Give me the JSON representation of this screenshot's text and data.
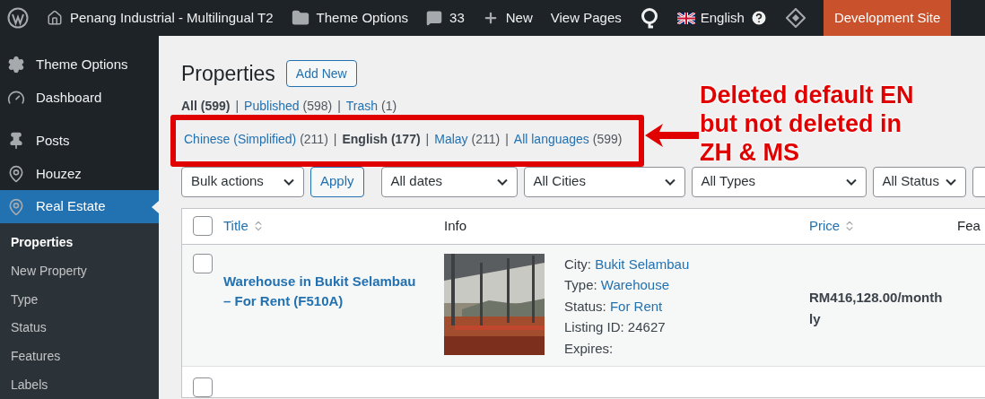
{
  "admin_bar": {
    "site_name": "Penang Industrial - Multilingual T2",
    "theme_options": "Theme Options",
    "comments": "33",
    "new": "New",
    "view_pages": "View Pages",
    "language": "English",
    "environment": "Development Site"
  },
  "sidebar": {
    "items": [
      {
        "label": "Theme Options",
        "selected": false
      },
      {
        "label": "Dashboard",
        "selected": false
      },
      {
        "label": "Posts",
        "selected": false
      },
      {
        "label": "Houzez",
        "selected": false
      },
      {
        "label": "Real Estate",
        "selected": true
      }
    ],
    "submenu": [
      {
        "label": "Properties",
        "selected": true
      },
      {
        "label": "New Property",
        "selected": false
      },
      {
        "label": "Type",
        "selected": false
      },
      {
        "label": "Status",
        "selected": false
      },
      {
        "label": "Features",
        "selected": false
      },
      {
        "label": "Labels",
        "selected": false
      }
    ]
  },
  "page": {
    "title": "Properties",
    "add_new": "Add New",
    "status_links": [
      {
        "label": "All",
        "count": "(599)",
        "selected": true
      },
      {
        "separator": "|",
        "label": "Published",
        "count": "(598)",
        "selected": false
      },
      {
        "separator": "|",
        "label": "Trash",
        "count": "(1)",
        "selected": false
      }
    ],
    "language_links": [
      {
        "label": "Chinese (Simplified)",
        "count": "(211)",
        "selected": false
      },
      {
        "separator": "|",
        "label": "English",
        "count": "(177)",
        "selected": true
      },
      {
        "separator": "|",
        "label": "Malay",
        "count": "(211)",
        "selected": false
      },
      {
        "separator": "|",
        "label": "All languages",
        "count": "(599)",
        "selected": false
      }
    ]
  },
  "filters": {
    "bulk_actions": "Bulk actions",
    "apply": "Apply",
    "dropdowns": [
      "All dates",
      "All Cities",
      "All Types",
      "All Status"
    ]
  },
  "table": {
    "select_all_checked": false,
    "columns": [
      {
        "label": "Title",
        "sortable": true
      },
      {
        "label": "Info",
        "sortable": false
      },
      {
        "label": "Price",
        "sortable": true
      },
      {
        "label": "Fea",
        "sortable": false
      }
    ],
    "rows": [
      {
        "checked": false,
        "title": "Warehouse in Bukit Selambau – For Rent (F510A)",
        "image": {
          "kind": "picture"
        },
        "info": [
          {
            "label": "City:",
            "value": "Bukit Selambau"
          },
          {
            "label": "Type:",
            "value": "Warehouse"
          },
          {
            "label": "Status:",
            "value": "For Rent"
          },
          {
            "label": "Listing ID: 24627"
          },
          {
            "label": "Expires:"
          }
        ],
        "price_lines": [
          "RM416,128.00/month",
          "ly"
        ]
      },
      {
        "checked": false
      }
    ]
  },
  "annotation": {
    "lines": [
      "Deleted default EN",
      "but not deleted in",
      "ZH & MS"
    ]
  }
}
